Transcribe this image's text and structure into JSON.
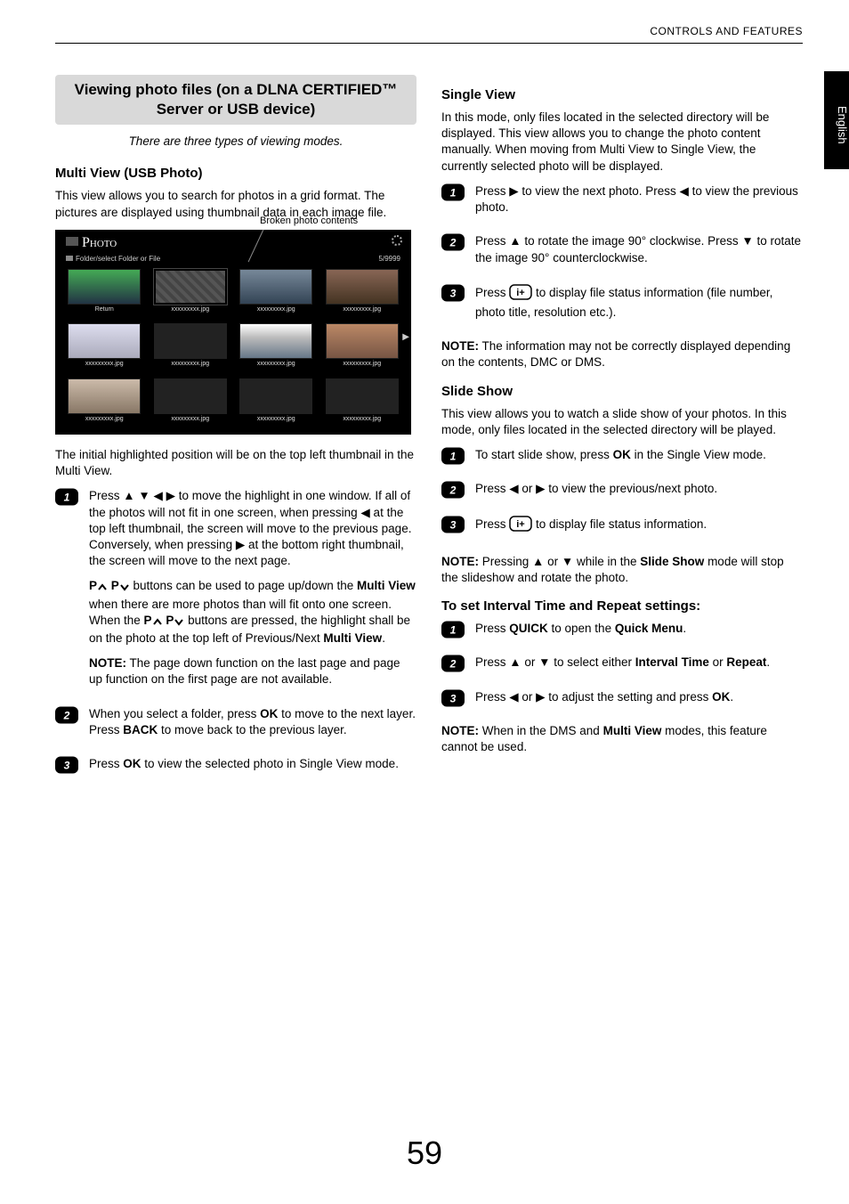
{
  "header": {
    "section": "CONTROLS AND FEATURES",
    "side_tab": "English"
  },
  "page_number": "59",
  "left": {
    "box_title": "Viewing photo files (on a DLNA CERTIFIED™ Server or USB device)",
    "intro": "There are three types of viewing modes.",
    "h_multi": "Multi View (USB Photo)",
    "p_multi_intro": "This view allows you to search for photos in a grid format. The pictures are displayed using thumbnail data in each image file.",
    "mock": {
      "broken_label": "Broken photo contents",
      "title": "Photo",
      "folder_hint": "Folder/select Folder or File",
      "counter": "5/9999",
      "return": "Return",
      "fname": "xxxxxxxxx.jpg"
    },
    "p_after_mock": "The initial highlighted position will be on the top left thumbnail in the Multi View.",
    "step1a": "Press ▲ ▼ ◀ ▶ to move the highlight in one window. If all of the photos will not fit in one screen, when pressing ◀ at the top left thumbnail, the screen will move to the previous page. Conversely, when pressing ▶ at the bottom right thumbnail, the screen will move to the next page.",
    "step1b_pre": "P",
    "step1b_mid": " P",
    "step1b_post": " buttons can be used to page up/down the ",
    "step1b_bold": "Multi View",
    "step1b_cont1": " when there are more photos than will fit onto one screen. When the ",
    "step1b_pre2": "P",
    "step1b_mid2": " P",
    "step1b_cont2": " buttons are pressed, the highlight shall be on the photo at the top left of Previous/Next ",
    "step1b_bold2": "Multi View",
    "step1b_end": ".",
    "step1_note": " The page down function on the last page and page up function on the first page are not available.",
    "step2_a": "When you select a folder, press ",
    "step2_ok": "OK",
    "step2_b": " to move to the next layer. Press ",
    "step2_back": "BACK",
    "step2_c": " to move back to the previous layer.",
    "step3_a": "Press ",
    "step3_ok": "OK",
    "step3_b": " to view the selected photo in Single View mode."
  },
  "right": {
    "h_single": "Single View",
    "p_single": "In this mode, only files located in the selected directory will be displayed. This view allows you to change the photo content manually. When moving from Multi View to Single View, the currently selected photo will be displayed.",
    "sv1": "Press ▶ to view the next photo. Press ◀ to view the previous photo.",
    "sv2": "Press ▲ to rotate the image 90° clockwise. Press ▼ to rotate the image 90° counterclockwise.",
    "sv3_a": "Press ",
    "sv3_b": " to display file status information (file number, photo title, resolution etc.).",
    "sv_note": " The information may not be correctly displayed depending on the contents, DMC or DMS.",
    "h_slide": "Slide Show",
    "p_slide": "This view allows you to watch a slide show of your photos. In this mode, only files located in the selected directory will be played.",
    "ss1_a": "To start slide show, press ",
    "ss1_ok": "OK",
    "ss1_b": " in the Single View mode.",
    "ss2": "Press ◀ or ▶ to view the previous/next photo.",
    "ss3_a": "Press ",
    "ss3_b": " to display file status information.",
    "ss_note_a": " Pressing ▲ or ▼ while in the ",
    "ss_note_bold": "Slide Show",
    "ss_note_b": " mode will stop the slideshow and rotate the photo.",
    "h_interval": "To set Interval Time and Repeat settings:",
    "it1_a": "Press ",
    "it1_quick": "QUICK",
    "it1_b": " to open the ",
    "it1_qm": "Quick Menu",
    "it1_c": ".",
    "it2_a": "Press ▲ or ▼ to select either ",
    "it2_b1": "Interval Time",
    "it2_or": " or ",
    "it2_b2": "Repeat",
    "it2_c": ".",
    "it3_a": "Press ◀ or ▶ to adjust the setting and press ",
    "it3_ok": "OK",
    "it3_b": ".",
    "it_note_a": " When in the DMS and ",
    "it_note_bold": "Multi View",
    "it_note_b": " modes, this feature cannot be used."
  },
  "labels": {
    "note": "NOTE:"
  }
}
